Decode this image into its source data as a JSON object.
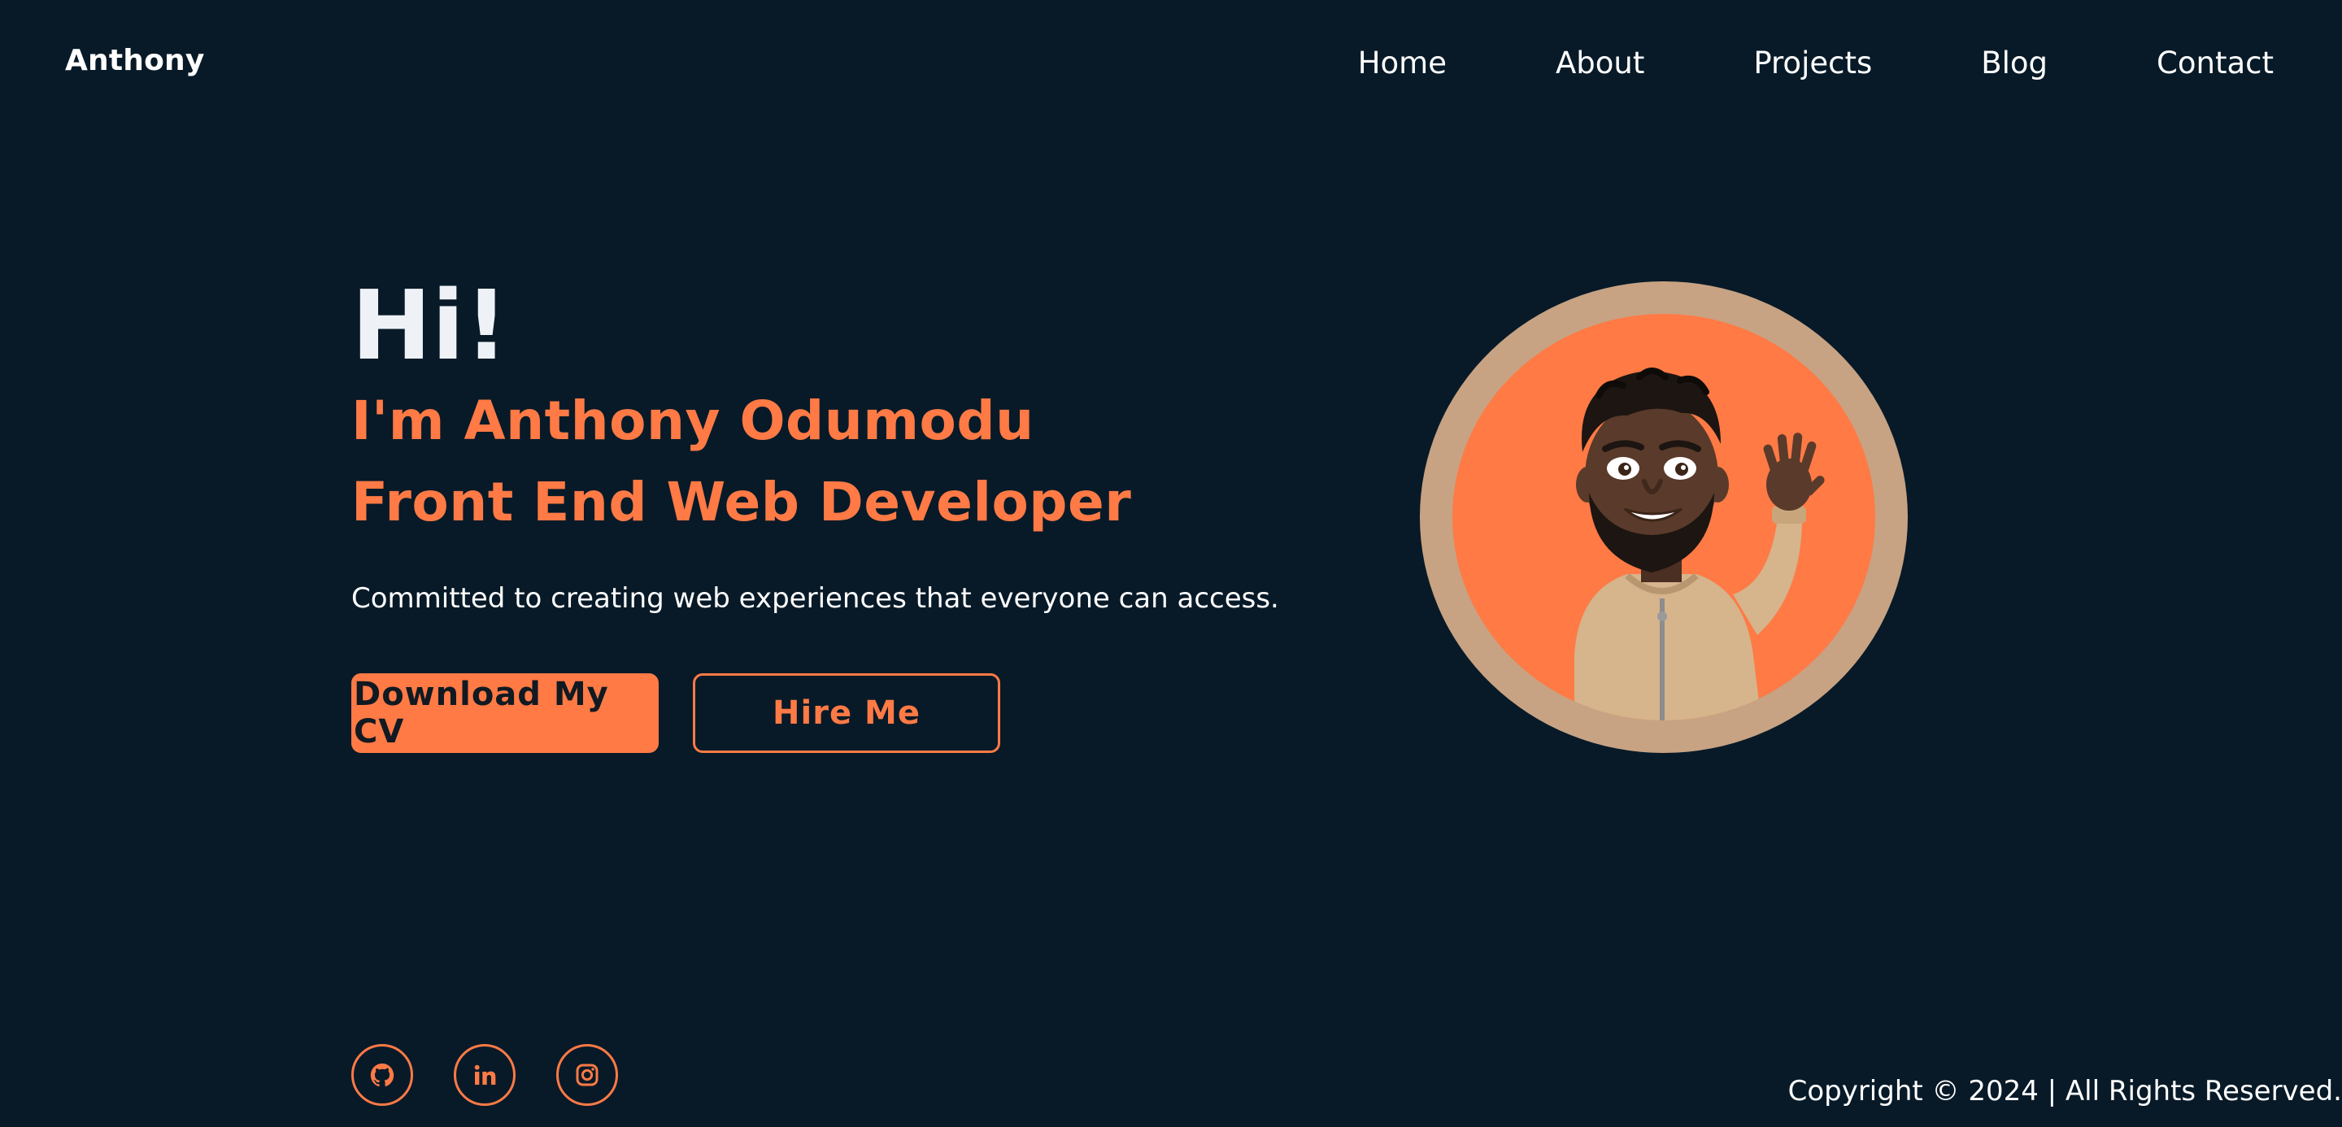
{
  "brand": {
    "name": "Anthony"
  },
  "nav": {
    "items": [
      {
        "label": "Home"
      },
      {
        "label": "About"
      },
      {
        "label": "Projects"
      },
      {
        "label": "Blog"
      },
      {
        "label": "Contact"
      }
    ]
  },
  "hero": {
    "greeting": "Hi!",
    "name": "I'm Anthony Odumodu",
    "role": "Front End Web Developer",
    "tagline": "Committed to creating web experiences that everyone can access.",
    "primary_button": "Download My CV",
    "secondary_button": "Hire Me"
  },
  "avatar": {
    "icon": "waving-memoji-avatar"
  },
  "social": {
    "links": [
      {
        "icon": "github-icon"
      },
      {
        "icon": "linkedin-icon"
      },
      {
        "icon": "instagram-icon"
      }
    ]
  },
  "footer": {
    "copyright": "Copyright © 2024 | All Rights Reserved."
  },
  "colors": {
    "background": "#081a28",
    "accent": "#ff7a45",
    "avatar_ring": "#c7a383",
    "text": "#ffffff"
  }
}
